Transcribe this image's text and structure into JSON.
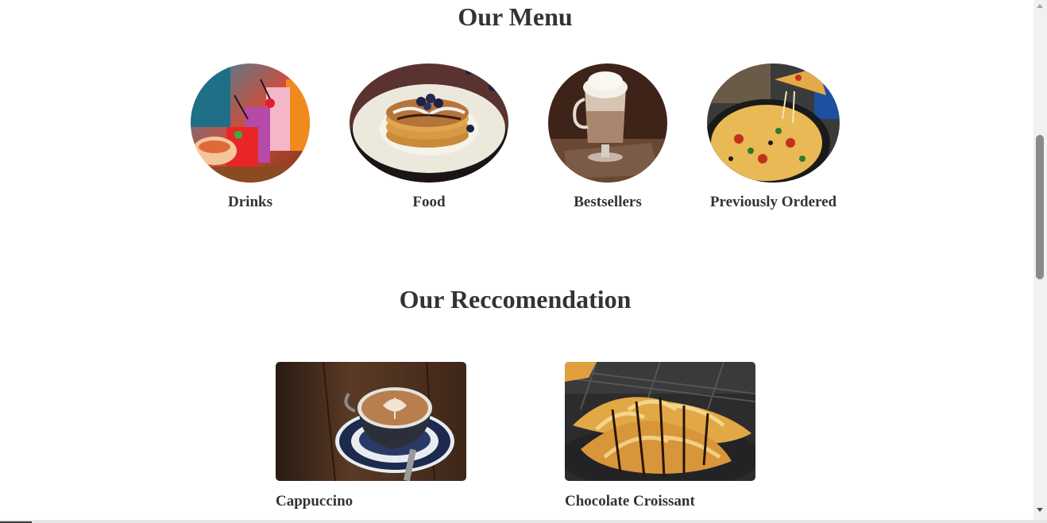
{
  "menu": {
    "title": "Our Menu",
    "items": [
      {
        "label": "Drinks",
        "image": "colorful-drinks"
      },
      {
        "label": "Food",
        "image": "pancakes"
      },
      {
        "label": "Bestsellers",
        "image": "latte-glass"
      },
      {
        "label": "Previously Ordered",
        "image": "pizza"
      }
    ]
  },
  "recommendation": {
    "title": "Our Reccomendation",
    "items": [
      {
        "label": "Cappuccino",
        "image": "cappuccino-cup"
      },
      {
        "label": "Chocolate Croissant",
        "image": "chocolate-croissant"
      }
    ]
  },
  "colors": {
    "text": "#333333",
    "background": "#ffffff",
    "scrollbar_thumb": "#8a8a8a"
  }
}
